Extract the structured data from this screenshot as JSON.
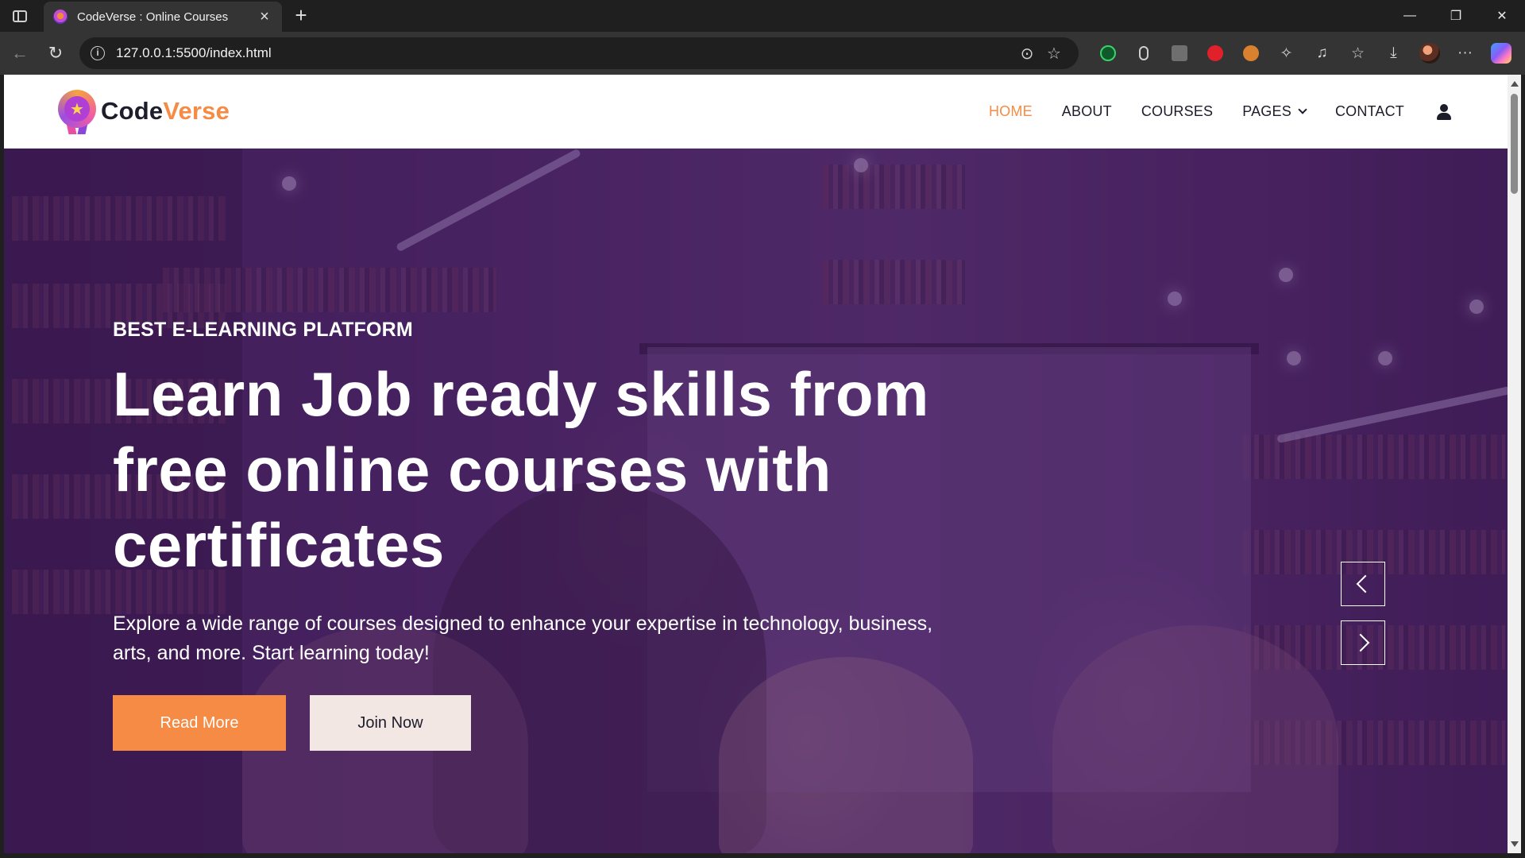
{
  "browser": {
    "tab": {
      "title": "CodeVerse : Online Courses",
      "close_icon": "×"
    },
    "new_tab_icon": "+",
    "url": "127.0.0.1:5500/index.html",
    "window_controls": {
      "minimize": "—",
      "restore": "❐",
      "close": "✕"
    },
    "nav": {
      "back": "←",
      "reload": "↻"
    },
    "toolbar": {
      "reader": "⊙",
      "favorite": "☆",
      "more": "···"
    }
  },
  "site": {
    "brand": {
      "part1": "Code",
      "part2": "Verse",
      "accent_color": "#f58b44"
    },
    "menu": [
      {
        "label": "HOME",
        "active": true
      },
      {
        "label": "ABOUT"
      },
      {
        "label": "COURSES"
      },
      {
        "label": "PAGES",
        "has_dropdown": true
      },
      {
        "label": "CONTACT"
      }
    ]
  },
  "hero": {
    "eyebrow": "BEST E-LEARNING PLATFORM",
    "title": "Learn Job ready skills from free online courses with certificates",
    "description": "Explore a wide range of courses designed to enhance your expertise in technology, business, arts, and more. Start learning today!",
    "buttons": {
      "read_more": "Read More",
      "join_now": "Join Now"
    }
  }
}
